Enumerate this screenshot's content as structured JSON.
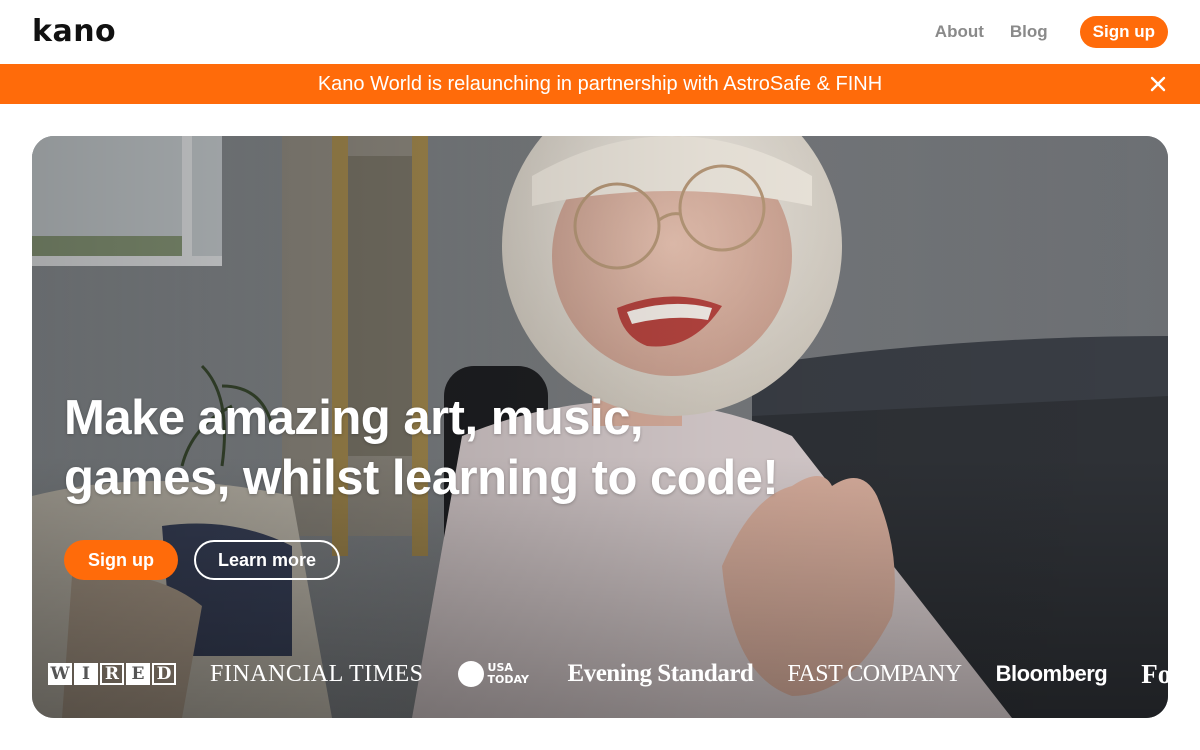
{
  "brand": {
    "logo_text": "kano"
  },
  "nav": {
    "about": "About",
    "blog": "Blog",
    "signup": "Sign up"
  },
  "banner": {
    "text": "Kano World is relaunching in partnership with AstroSafe & FINH",
    "close_icon": "close-icon"
  },
  "hero": {
    "headline_line1": "Make amazing art, music,",
    "headline_line2": "games, whilst learning to code!",
    "primary_cta": "Sign up",
    "secondary_cta": "Learn more"
  },
  "press": {
    "wired": "WIRED",
    "financial_times": "FINANCIAL TIMES",
    "usa_today_line1": "USA",
    "usa_today_line2": "TODAY",
    "evening_standard": "Evening Standard",
    "fast_company": "FAST COMPANY",
    "bloomberg": "Bloomberg",
    "forbes": "Forbes"
  },
  "colors": {
    "accent": "#ff6b0a",
    "nav_text": "#8a8a8a",
    "white": "#ffffff"
  }
}
